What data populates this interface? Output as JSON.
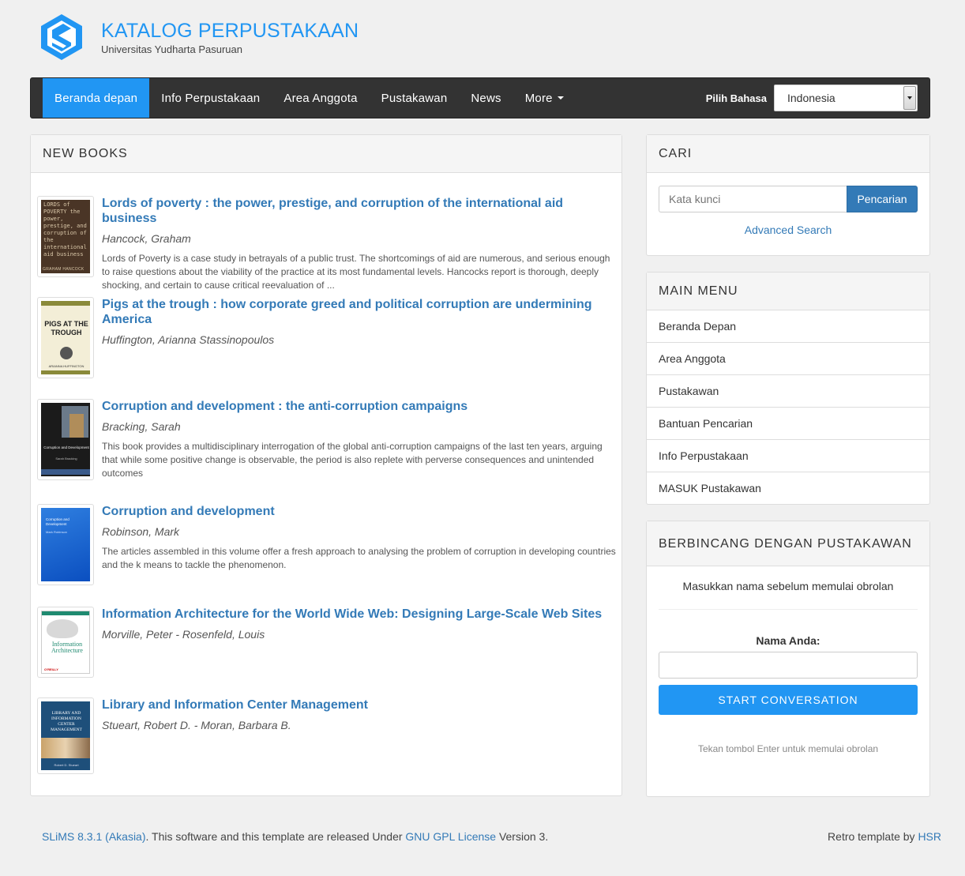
{
  "header": {
    "title": "KATALOG PERPUSTAKAAN",
    "subtitle": "Universitas Yudharta Pasuruan"
  },
  "navbar": {
    "items": [
      "Beranda depan",
      "Info Perpustakaan",
      "Area Anggota",
      "Pustakawan",
      "News",
      "More"
    ],
    "language_label": "Pilih Bahasa",
    "language_selected": "Indonesia"
  },
  "new_books": {
    "heading": "NEW BOOKS",
    "books": [
      {
        "title": "Lords of poverty : the power, prestige, and corruption of the international aid business",
        "author": "Hancock, Graham",
        "description": "Lords of Poverty is a case study in betrayals of a public trust. The shortcomings of aid are numerous, and serious enough to raise questions about the viability of the practice at its most fundamental levels. Hancocks report is thorough, deeply shocking, and certain to cause critical reevaluation of ...",
        "cover_text": "LORDS of POVERTY the power, prestige, and corruption of the international aid business",
        "cover_author": "GRAHAM HANCOCK"
      },
      {
        "title": "Pigs at the trough : how corporate greed and political corruption are undermining America",
        "author": "Huffington, Arianna Stassinopoulos",
        "description": "",
        "cover_text": "PIGS AT THE TROUGH",
        "cover_author": "ARIANNA HUFFINGTON"
      },
      {
        "title": "Corruption and development : the anti-corruption campaigns",
        "author": "Bracking, Sarah",
        "description": "This book provides a multidisciplinary interrogation of the global anti-corruption campaigns of the last ten years, arguing that while some positive change is observable, the period is also replete with perverse consequences and unintended outcomes",
        "cover_text": "Corruption and Development",
        "cover_author": "Sarah Bracking"
      },
      {
        "title": "Corruption and development",
        "author": "Robinson, Mark",
        "description": "The articles assembled in this volume offer a fresh approach to analysing the problem of corruption in developing countries and the k means to tackle the phenomenon.",
        "cover_text": "Corruption and Development",
        "cover_author": "Mark Robinson"
      },
      {
        "title": "Information Architecture for the World Wide Web: Designing Large-Scale Web Sites",
        "author": "Morville, Peter - Rosenfeld, Louis",
        "description": "",
        "cover_text": "Information Architecture",
        "cover_author": "O'REILLY"
      },
      {
        "title": "Library and Information Center Management",
        "author": "Stueart, Robert D. - Moran, Barbara B.",
        "description": "",
        "cover_text": "LIBRARY AND INFORMATION CENTER MANAGEMENT",
        "cover_author": "Robert D. Stueart"
      }
    ]
  },
  "search": {
    "heading": "CARI",
    "placeholder": "Kata kunci",
    "button": "Pencarian",
    "advanced": "Advanced Search"
  },
  "main_menu": {
    "heading": "MAIN MENU",
    "items": [
      "Beranda Depan",
      "Area Anggota",
      "Pustakawan",
      "Bantuan Pencarian",
      "Info Perpustakaan",
      "MASUK Pustakawan"
    ]
  },
  "chat": {
    "heading": "BERBINCANG DENGAN PUSTAKAWAN",
    "intro": "Masukkan nama sebelum memulai obrolan",
    "name_label": "Nama Anda:",
    "button": "START CONVERSATION",
    "hint": "Tekan tombol Enter untuk memulai obrolan"
  },
  "footer": {
    "slims_link": "SLiMS 8.3.1 (Akasia)",
    "text_1": ". This software and this template are released Under ",
    "license_link": "GNU GPL License",
    "text_2": " Version 3.",
    "retro_text": "Retro template by ",
    "author_link": "HSR"
  },
  "colors": {
    "brand": "#2196f3",
    "link": "#337ab7",
    "navbar": "#333333"
  }
}
